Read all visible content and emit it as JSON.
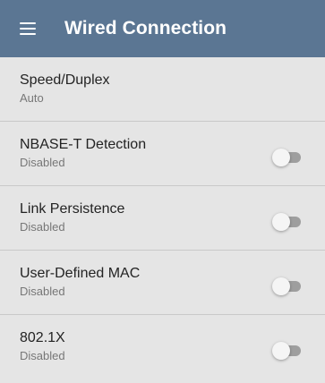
{
  "appbar": {
    "title": "Wired Connection",
    "menu_icon": "hamburger-menu-icon",
    "color": "#5b7693"
  },
  "settings": [
    {
      "label": "Speed/Duplex",
      "value": "Auto",
      "toggle": null
    },
    {
      "label": "NBASE-T Detection",
      "value": "Disabled",
      "toggle": false
    },
    {
      "label": "Link Persistence",
      "value": "Disabled",
      "toggle": false
    },
    {
      "label": "User-Defined MAC",
      "value": "Disabled",
      "toggle": false
    },
    {
      "label": "802.1X",
      "value": "Disabled",
      "toggle": false
    }
  ]
}
